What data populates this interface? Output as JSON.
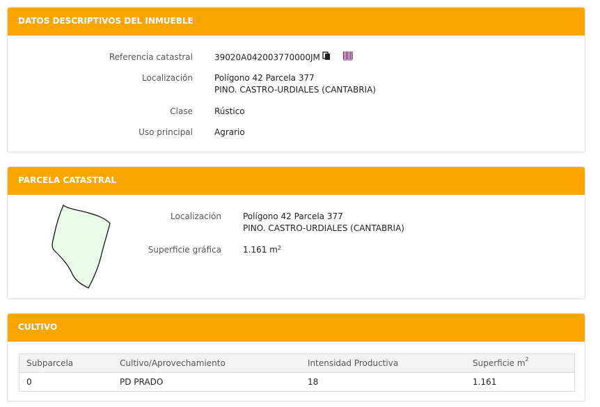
{
  "inmueble": {
    "title": "DATOS DESCRIPTIVOS DEL INMUEBLE",
    "referencia_label": "Referencia catastral",
    "referencia_value": "39020A042003770000JM",
    "localizacion_label": "Localización",
    "localizacion_line1": "Polígono 42 Parcela 377",
    "localizacion_line2": "PINO. CASTRO-URDIALES (CANTABRIA)",
    "clase_label": "Clase",
    "clase_value": "Rústico",
    "uso_label": "Uso principal",
    "uso_value": "Agrario",
    "icons": [
      "copy-icon",
      "barcode-icon"
    ]
  },
  "parcela": {
    "title": "PARCELA CATASTRAL",
    "localizacion_label": "Localización",
    "localizacion_line1": "Polígono 42 Parcela 377",
    "localizacion_line2": "PINO. CASTRO-URDIALES (CANTABRIA)",
    "superficie_label": "Superficie gráfica",
    "superficie_value": "1.161 m",
    "superficie_unit_sup": "2",
    "parcel_fill": "#e8fbe8"
  },
  "cultivo": {
    "title": "CULTIVO",
    "columns": [
      "Subparcela",
      "Cultivo/Aprovechamiento",
      "Intensidad Productiva",
      "Superficie m"
    ],
    "column_sup": "2",
    "rows": [
      [
        "0",
        "PD PRADO",
        "18",
        "1.161"
      ]
    ]
  },
  "colors": {
    "header_bg": "#fba600",
    "header_text": "#ffffff"
  }
}
